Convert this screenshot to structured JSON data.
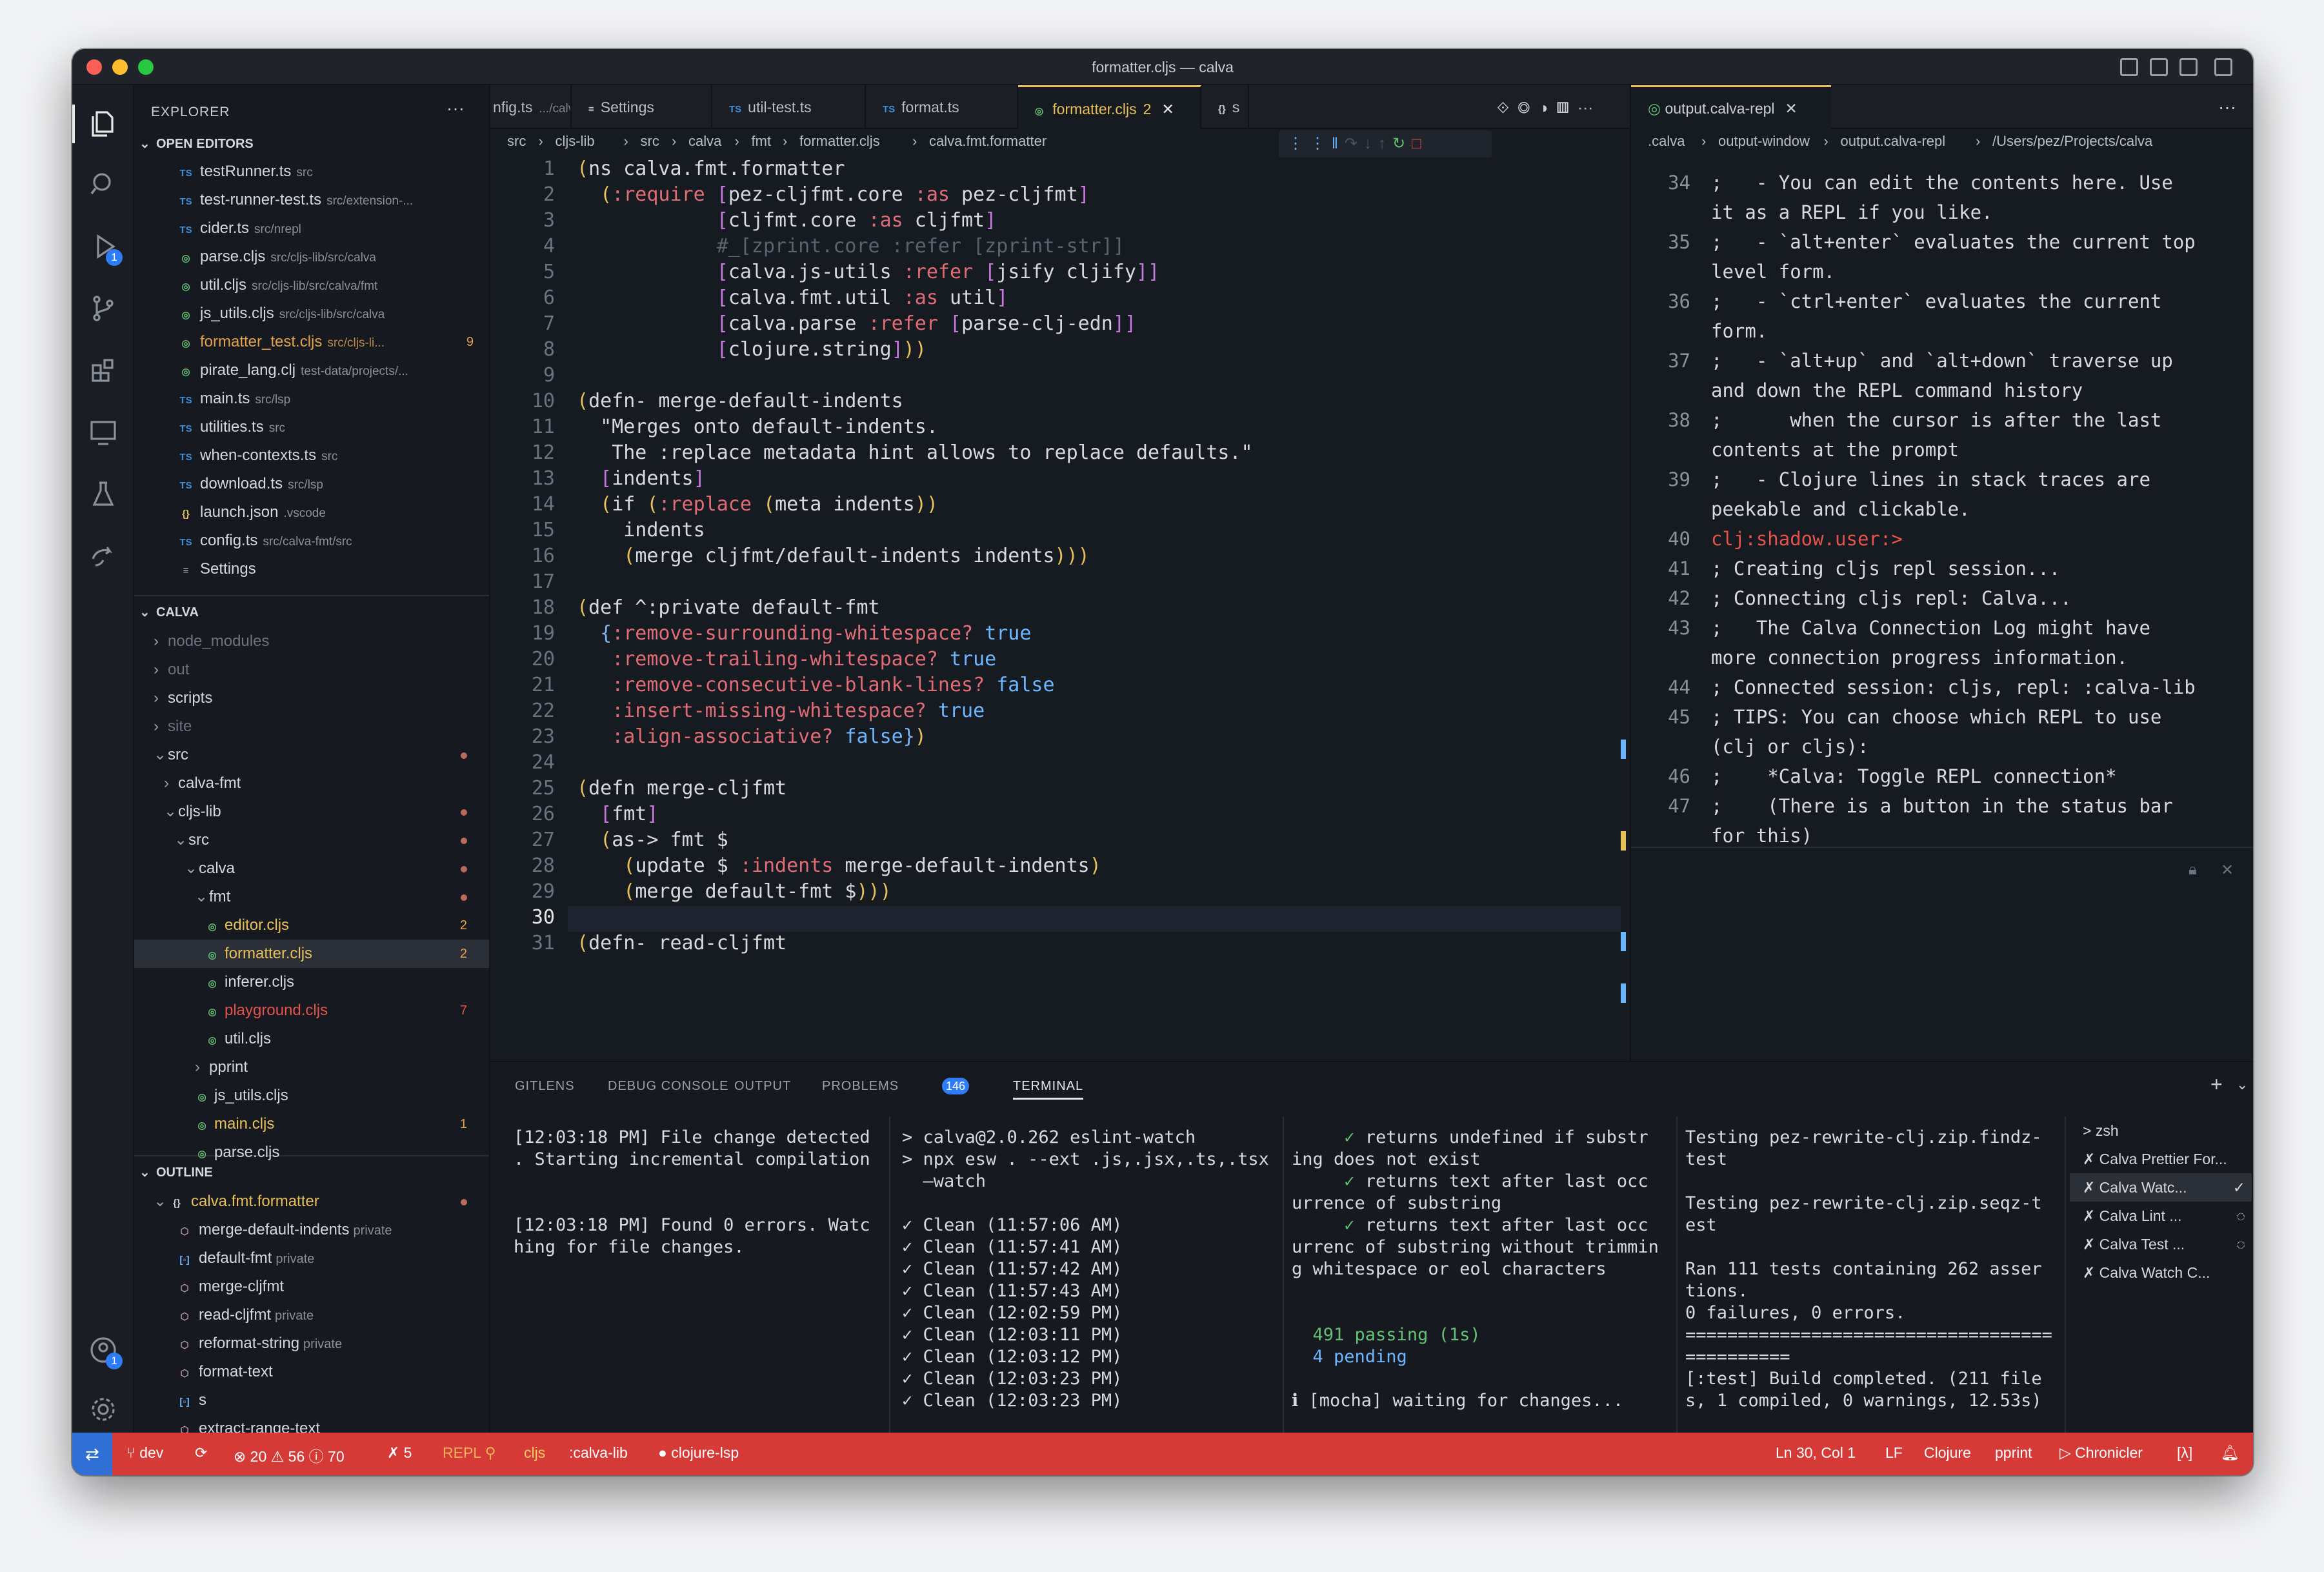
{
  "window": {
    "title": "formatter.cljs — calva"
  },
  "explorer": {
    "title": "EXPLORER",
    "open_editors": "OPEN EDITORS",
    "project": "CALVA",
    "outline": "OUTLINE"
  },
  "open_editors": [
    {
      "icon": "TS",
      "name": "testRunner.ts",
      "dir": "src"
    },
    {
      "icon": "TS",
      "name": "test-runner-test.ts",
      "dir": "src/extension-..."
    },
    {
      "icon": "TS",
      "name": "cider.ts",
      "dir": "src/nrepl"
    },
    {
      "icon": "clj",
      "name": "parse.cljs",
      "dir": "src/cljs-lib/src/calva"
    },
    {
      "icon": "clj",
      "name": "util.cljs",
      "dir": "src/cljs-lib/src/calva/fmt"
    },
    {
      "icon": "clj",
      "name": "js_utils.cljs",
      "dir": "src/cljs-lib/src/calva"
    },
    {
      "icon": "clj",
      "name": "formatter_test.cljs",
      "dir": "src/cljs-li...",
      "count": "9",
      "warn": true
    },
    {
      "icon": "clj",
      "name": "pirate_lang.clj",
      "dir": "test-data/projects/..."
    },
    {
      "icon": "TS",
      "name": "main.ts",
      "dir": "src/lsp"
    },
    {
      "icon": "TS",
      "name": "utilities.ts",
      "dir": "src"
    },
    {
      "icon": "TS",
      "name": "when-contexts.ts",
      "dir": "src"
    },
    {
      "icon": "TS",
      "name": "download.ts",
      "dir": "src/lsp"
    },
    {
      "icon": "{}",
      "name": "launch.json",
      "dir": ".vscode"
    },
    {
      "icon": "TS",
      "name": "config.ts",
      "dir": "src/calva-fmt/src"
    },
    {
      "icon": "≡",
      "name": "Settings",
      "dir": ""
    }
  ],
  "tree": [
    {
      "name": "node_modules",
      "indent": 0,
      "chev": "›",
      "dim": true
    },
    {
      "name": "out",
      "indent": 0,
      "chev": "›",
      "dim": true
    },
    {
      "name": "scripts",
      "indent": 0,
      "chev": "›"
    },
    {
      "name": "site",
      "indent": 0,
      "chev": "›",
      "dim": true
    },
    {
      "name": "src",
      "indent": 0,
      "chev": "⌄",
      "mod": true
    },
    {
      "name": "calva-fmt",
      "indent": 1,
      "chev": "›"
    },
    {
      "name": "cljs-lib",
      "indent": 1,
      "chev": "⌄",
      "mod": true
    },
    {
      "name": "src",
      "indent": 2,
      "chev": "⌄",
      "mod": true
    },
    {
      "name": "calva",
      "indent": 3,
      "chev": "⌄",
      "mod": true
    },
    {
      "name": "fmt",
      "indent": 4,
      "chev": "⌄",
      "mod": true
    },
    {
      "name": "editor.cljs",
      "indent": 5,
      "file": true,
      "count": "2",
      "warn": true
    },
    {
      "name": "formatter.cljs",
      "indent": 5,
      "file": true,
      "count": "2",
      "warn": true,
      "selected": true
    },
    {
      "name": "inferer.cljs",
      "indent": 5,
      "file": true
    },
    {
      "name": "playground.cljs",
      "indent": 5,
      "file": true,
      "count": "7",
      "err": true
    },
    {
      "name": "util.cljs",
      "indent": 5,
      "file": true
    },
    {
      "name": "pprint",
      "indent": 4,
      "chev": "›"
    },
    {
      "name": "js_utils.cljs",
      "indent": 4,
      "file": true
    },
    {
      "name": "main.cljs",
      "indent": 4,
      "file": true,
      "count": "1",
      "warn": true
    },
    {
      "name": "parse.cljs",
      "indent": 4,
      "file": true
    }
  ],
  "outline": [
    {
      "name": "calva.fmt.formatter",
      "kind": "{}",
      "indent": 0,
      "ns": true
    },
    {
      "name": "merge-default-indents",
      "kind": "fn",
      "priv": "private",
      "indent": 1
    },
    {
      "name": "default-fmt",
      "kind": "var",
      "priv": "private",
      "indent": 1
    },
    {
      "name": "merge-cljfmt",
      "kind": "fn",
      "priv": "",
      "indent": 1
    },
    {
      "name": "read-cljfmt",
      "kind": "fn",
      "priv": "private",
      "indent": 1
    },
    {
      "name": "reformat-string",
      "kind": "fn",
      "priv": "private",
      "indent": 1
    },
    {
      "name": "format-text",
      "kind": "fn",
      "priv": "",
      "indent": 1
    },
    {
      "name": "s",
      "kind": "var",
      "priv": "",
      "indent": 1
    },
    {
      "name": "extract-range-text",
      "kind": "fn",
      "priv": "",
      "indent": 1
    }
  ],
  "tabs": [
    {
      "label": "nfig.ts",
      "dir": ".../calva-fmt/...",
      "icon": ""
    },
    {
      "label": "Settings",
      "icon": "≡"
    },
    {
      "label": "util-test.ts",
      "icon": "TS"
    },
    {
      "label": "format.ts",
      "icon": "TS"
    },
    {
      "label": "formatter.cljs",
      "count": "2",
      "icon": "clj",
      "active": true
    },
    {
      "label": "s",
      "icon": "{}"
    }
  ],
  "breadcrumb": [
    "src",
    "cljs-lib",
    "src",
    "calva",
    "fmt",
    "formatter.cljs",
    "calva.fmt.formatter"
  ],
  "code": [
    {
      "n": "1",
      "t": "(ns calva.fmt.formatter"
    },
    {
      "n": "2",
      "t": "  (:require [pez-cljfmt.core :as pez-cljfmt]"
    },
    {
      "n": "3",
      "t": "            [cljfmt.core :as cljfmt]"
    },
    {
      "n": "4",
      "t": "            #_[zprint.core :refer [zprint-str]]"
    },
    {
      "n": "5",
      "t": "            [calva.js-utils :refer [jsify cljify]]"
    },
    {
      "n": "6",
      "t": "            [calva.fmt.util :as util]"
    },
    {
      "n": "7",
      "t": "            [calva.parse :refer [parse-clj-edn]]"
    },
    {
      "n": "8",
      "t": "            [clojure.string]))"
    },
    {
      "n": "9",
      "t": ""
    },
    {
      "n": "10",
      "t": "(defn- merge-default-indents"
    },
    {
      "n": "11",
      "t": "  \"Merges onto default-indents."
    },
    {
      "n": "12",
      "t": "   The :replace metadata hint allows to replace defaults.\""
    },
    {
      "n": "13",
      "t": "  [indents]"
    },
    {
      "n": "14",
      "t": "  (if (:replace (meta indents))"
    },
    {
      "n": "15",
      "t": "    indents"
    },
    {
      "n": "16",
      "t": "    (merge cljfmt/default-indents indents)))"
    },
    {
      "n": "17",
      "t": ""
    },
    {
      "n": "18",
      "t": "(def ^:private default-fmt"
    },
    {
      "n": "19",
      "t": "  {:remove-surrounding-whitespace? true"
    },
    {
      "n": "20",
      "t": "   :remove-trailing-whitespace? true"
    },
    {
      "n": "21",
      "t": "   :remove-consecutive-blank-lines? false"
    },
    {
      "n": "22",
      "t": "   :insert-missing-whitespace? true"
    },
    {
      "n": "23",
      "t": "   :align-associative? false})"
    },
    {
      "n": "24",
      "t": ""
    },
    {
      "n": "25",
      "t": "(defn merge-cljfmt"
    },
    {
      "n": "26",
      "t": "  [fmt]"
    },
    {
      "n": "27",
      "t": "  (as-> fmt $"
    },
    {
      "n": "28",
      "t": "    (update $ :indents merge-default-indents)"
    },
    {
      "n": "29",
      "t": "    (merge default-fmt $)))"
    },
    {
      "n": "30",
      "t": ""
    },
    {
      "n": "31",
      "t": "(defn- read-cljfmt"
    }
  ],
  "right": {
    "tab": "output.calva-repl",
    "breadcrumb": [
      ".calva",
      "output-window",
      "output.calva-repl",
      "/Users/pez/Projects/calva"
    ],
    "lines": [
      {
        "n": "34",
        "t": ";   - You can edit the contents here. Use"
      },
      {
        "n": "",
        "t": "it as a REPL if you like."
      },
      {
        "n": "35",
        "t": ";   - `alt+enter` evaluates the current top"
      },
      {
        "n": "",
        "t": "level form."
      },
      {
        "n": "36",
        "t": ";   - `ctrl+enter` evaluates the current"
      },
      {
        "n": "",
        "t": "form."
      },
      {
        "n": "37",
        "t": ";   - `alt+up` and `alt+down` traverse up"
      },
      {
        "n": "",
        "t": "and down the REPL command history"
      },
      {
        "n": "38",
        "t": ";      when the cursor is after the last"
      },
      {
        "n": "",
        "t": "contents at the prompt"
      },
      {
        "n": "39",
        "t": ";   - Clojure lines in stack traces are"
      },
      {
        "n": "",
        "t": "peekable and clickable."
      },
      {
        "n": "40",
        "t": "clj:shadow.user:>"
      },
      {
        "n": "41",
        "t": "; Creating cljs repl session..."
      },
      {
        "n": "42",
        "t": "; Connecting cljs repl: Calva..."
      },
      {
        "n": "43",
        "t": ";   The Calva Connection Log might have"
      },
      {
        "n": "",
        "t": "more connection progress information."
      },
      {
        "n": "44",
        "t": "; Connected session: cljs, repl: :calva-lib"
      },
      {
        "n": "45",
        "t": "; TIPS: You can choose which REPL to use"
      },
      {
        "n": "",
        "t": "(clj or cljs):"
      },
      {
        "n": "46",
        "t": ";    *Calva: Toggle REPL connection*"
      },
      {
        "n": "47",
        "t": ";    (There is a button in the status bar"
      },
      {
        "n": "",
        "t": "for this)"
      }
    ]
  },
  "panel": {
    "tabs": [
      "GITLENS",
      "DEBUG CONSOLE",
      "OUTPUT",
      "PROBLEMS",
      "TERMINAL"
    ],
    "problems_count": "146",
    "term1": "[12:03:18 PM] File change detected\n. Starting incremental compilation\n\n\n[12:03:18 PM] Found 0 errors. Watc\nhing for file changes.",
    "term2": "> calva@2.0.262 eslint-watch\n> npx esw . --ext .js,.jsx,.ts,.tsx\n  —watch\n\n✓ Clean (11:57:06 AM)\n✓ Clean (11:57:41 AM)\n✓ Clean (11:57:42 AM)\n✓ Clean (11:57:43 AM)\n✓ Clean (12:02:59 PM)\n✓ Clean (12:03:11 PM)\n✓ Clean (12:03:12 PM)\n✓ Clean (12:03:23 PM)\n✓ Clean (12:03:23 PM)",
    "term3": "     ✓ returns undefined if substr\ning does not exist\n     ✓ returns text after last occ\nurrence of substring\n     ✓ returns text after last occ\nurrenc of substring without trimmin\ng whitespace or eol characters\n\n\n  491 passing (1s)\n  4 pending\n\nℹ [mocha] waiting for changes...",
    "term4": "Testing pez-rewrite-clj.zip.findz-\ntest\n\nTesting pez-rewrite-clj.zip.seqz-t\nest\n\nRan 111 tests containing 262 asser\ntions.\n0 failures, 0 errors.\n===================================\n==========\n[:test] Build completed. (211 file\ns, 1 compiled, 0 warnings, 12.53s)",
    "terminals": [
      {
        "label": "zsh",
        "icon": ">"
      },
      {
        "label": "Calva Prettier For...",
        "icon": "✗"
      },
      {
        "label": "Calva Watc...",
        "icon": "✗",
        "active": true,
        "mark": "✓"
      },
      {
        "label": "Calva Lint ...",
        "icon": "✗",
        "mark": "◌"
      },
      {
        "label": "Calva Test ...",
        "icon": "✗",
        "mark": "◌"
      },
      {
        "label": "Calva Watch C...",
        "icon": "✗"
      }
    ]
  },
  "status": {
    "branch": "dev",
    "errors": "20",
    "warnings": "56",
    "info": "70",
    "tools": "5",
    "repl": "REPL",
    "cljs": "cljs",
    "session": ":calva-lib",
    "lsp": "clojure-lsp",
    "position": "Ln 30, Col 1",
    "eol": "LF",
    "lang": "Clojure",
    "fmt": "pprint",
    "chronicler": "Chronicler",
    "lambda": "[λ]"
  },
  "colors": {
    "accent": "#e8c05a",
    "status": "#d63a36",
    "badge": "#2f7df6"
  }
}
